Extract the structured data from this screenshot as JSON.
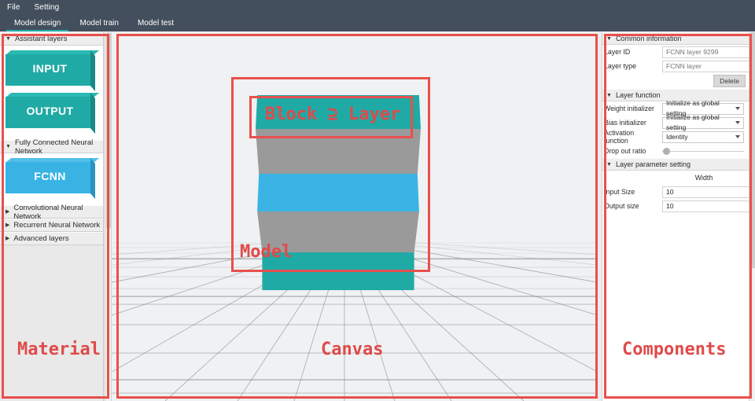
{
  "menu": {
    "items": [
      {
        "label": "File"
      },
      {
        "label": "Setting"
      }
    ]
  },
  "tabs": [
    {
      "label": "Model design",
      "active": true
    },
    {
      "label": "Model train",
      "active": false
    },
    {
      "label": "Model test",
      "active": false
    }
  ],
  "sidebar": {
    "sections": [
      {
        "title": "Assistant layers",
        "expanded": true,
        "blocks": [
          {
            "label": "INPUT",
            "color": "#20aaa5"
          },
          {
            "label": "OUTPUT",
            "color": "#20aaa5"
          }
        ]
      },
      {
        "title": "Fully Connected Neural Network",
        "expanded": true,
        "blocks": [
          {
            "label": "FCNN",
            "color": "#38b3e4"
          }
        ]
      },
      {
        "title": "Convolutional Neural Network",
        "expanded": false,
        "blocks": []
      },
      {
        "title": "Recurrent Neural Network",
        "expanded": false,
        "blocks": []
      },
      {
        "title": "Advanced layers",
        "expanded": false,
        "blocks": []
      }
    ],
    "expanded_icon": "▼",
    "collapsed_icon": "▶"
  },
  "canvas": {
    "model_slabs": [
      {
        "name": "top-teal-layer",
        "color": "#20aaa5"
      },
      {
        "name": "upper-gray-layer",
        "color": "#9a9a9a"
      },
      {
        "name": "middle-blue-layer",
        "color": "#3bb4e5"
      },
      {
        "name": "lower-gray-layer",
        "color": "#9a9a9a"
      },
      {
        "name": "bottom-teal-layer",
        "color": "#20aaa5"
      }
    ],
    "grid_color": "#7b7b7b",
    "background": "#eff1f3"
  },
  "annotations": {
    "material": "Material",
    "canvas": "Canvas",
    "components": "Components",
    "model": "Model",
    "block_layer": "Block ⊇ Layer",
    "color": "#e04a4a"
  },
  "right_panel": {
    "common_information": {
      "title": "Common information",
      "expanded_icon": "▼",
      "fields": [
        {
          "label": "Layer ID",
          "value": "",
          "placeholder": "FCNN layer 9299"
        },
        {
          "label": "Layer type",
          "value": "",
          "placeholder": "FCNN layer"
        }
      ],
      "delete_label": "Delete"
    },
    "layer_function": {
      "title": "Layer function",
      "expanded_icon": "▼",
      "selects": [
        {
          "label": "Weight initializer",
          "value": "Initialize as global setting"
        },
        {
          "label": "Bias initializer",
          "value": "Initialize as global setting"
        },
        {
          "label": "Activation function",
          "value": "Identity"
        }
      ],
      "slider": {
        "label": "Drop out ratio",
        "value": 0
      }
    },
    "layer_parameter_setting": {
      "title": "Layer parameter setting",
      "expanded_icon": "▼",
      "column_header": "Width",
      "rows": [
        {
          "label": "Input Size",
          "value": "10"
        },
        {
          "label": "Output size",
          "value": "10"
        }
      ]
    }
  }
}
